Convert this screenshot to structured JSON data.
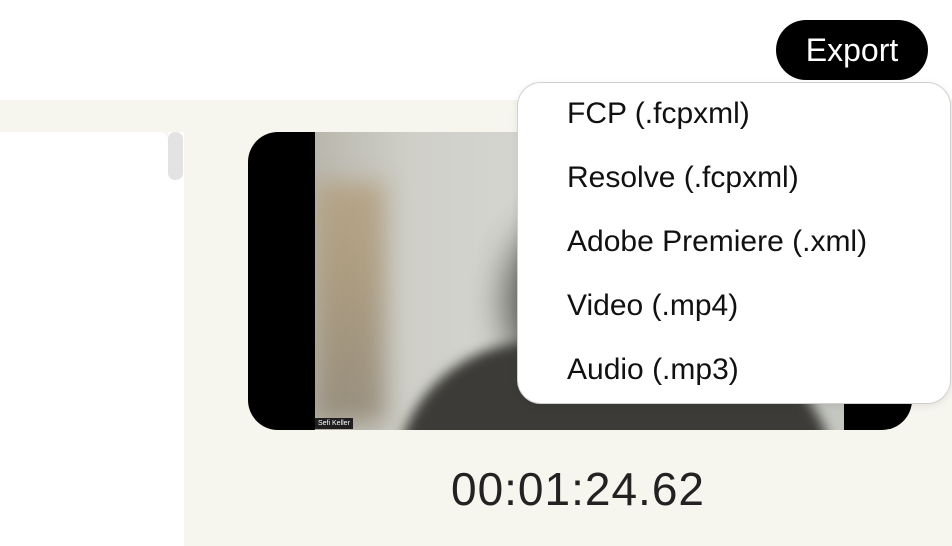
{
  "toolbar": {
    "export_label": "Export"
  },
  "export_menu": {
    "items": [
      {
        "label": "FCP (.fcpxml)"
      },
      {
        "label": "Resolve (.fcpxml)"
      },
      {
        "label": "Adobe Premiere (.xml)"
      },
      {
        "label": "Video (.mp4)"
      },
      {
        "label": "Audio (.mp3)"
      }
    ]
  },
  "player": {
    "speaker_name": "Sefi Keller",
    "timecode": "00:01:24.62"
  },
  "colors": {
    "workspace_bg": "#f6f5ee",
    "button_bg": "#000000",
    "button_text": "#ffffff"
  }
}
